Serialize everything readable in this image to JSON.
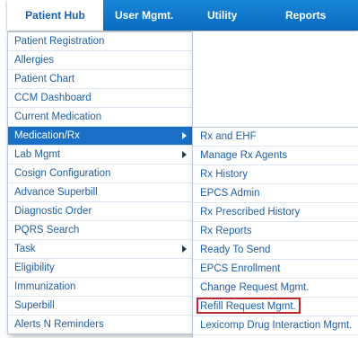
{
  "navbar": {
    "tabs": [
      {
        "label": "Patient Hub"
      },
      {
        "label": "User Mgmt."
      },
      {
        "label": "Utility"
      },
      {
        "label": "Reports"
      }
    ]
  },
  "main_menu": {
    "items": [
      {
        "label": "Patient Registration"
      },
      {
        "label": "Allergies"
      },
      {
        "label": "Patient Chart"
      },
      {
        "label": "CCM Dashboard"
      },
      {
        "label": "Current Medication"
      },
      {
        "label": "Medication/Rx"
      },
      {
        "label": "Lab Mgmt"
      },
      {
        "label": "Cosign Configuration"
      },
      {
        "label": "Advance Superbill"
      },
      {
        "label": "Diagnostic Order"
      },
      {
        "label": "PQRS Search"
      },
      {
        "label": "Task"
      },
      {
        "label": "Eligibility"
      },
      {
        "label": "Immunization"
      },
      {
        "label": "Superbill"
      },
      {
        "label": "Alerts N Reminders"
      }
    ]
  },
  "sub_menu": {
    "items": [
      {
        "label": "Rx and EHF"
      },
      {
        "label": "Manage Rx Agents"
      },
      {
        "label": "Rx History"
      },
      {
        "label": "EPCS Admin"
      },
      {
        "label": "Rx Prescribed History"
      },
      {
        "label": "Rx Reports"
      },
      {
        "label": "Ready To Send"
      },
      {
        "label": "EPCS Enrollment"
      },
      {
        "label": "Change Request Mgmt."
      },
      {
        "label": "Refill Request Mgmt."
      },
      {
        "label": "Lexicomp Drug Interaction Mgmt."
      }
    ]
  },
  "colors": {
    "navbar_bg": "#0b6cc0",
    "menu_text": "#1e5fa5",
    "selected_bg": "#1a6fc7",
    "highlight_border": "#c0262c"
  }
}
